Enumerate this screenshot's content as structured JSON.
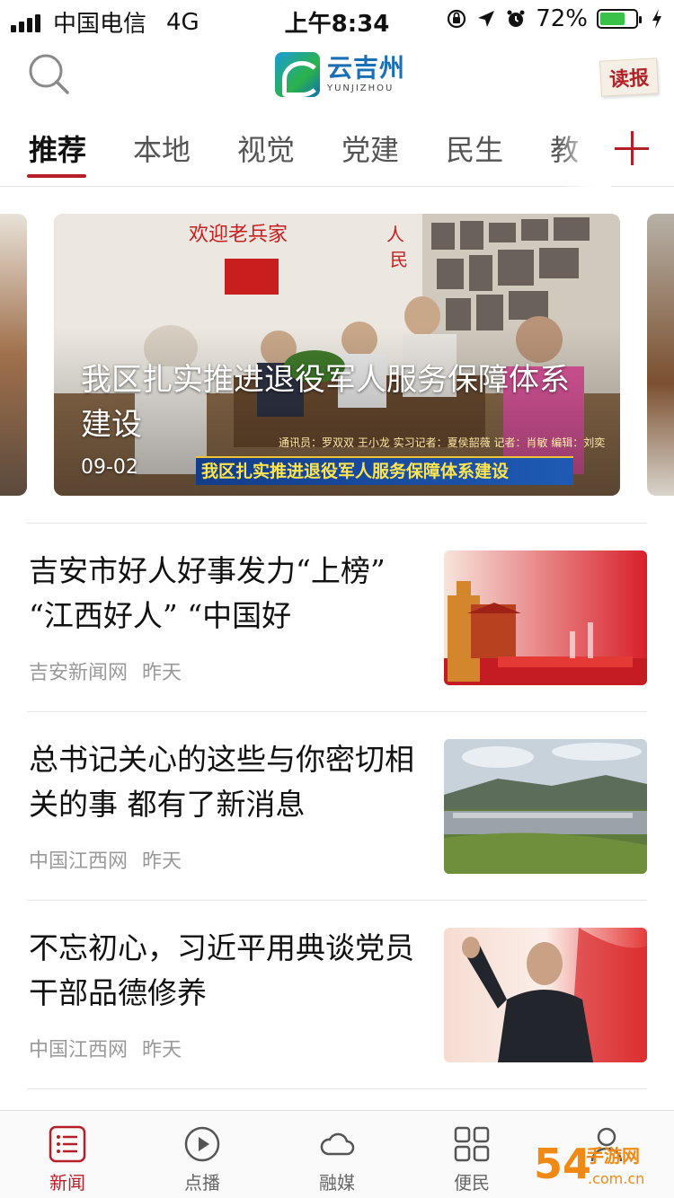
{
  "status_bar": {
    "carrier": "中国电信",
    "network": "4G",
    "time": "上午8:34",
    "battery": "72%",
    "battery_level": 0.72
  },
  "header": {
    "logo_cn": "云吉州",
    "logo_en": "YUNJIZHOU",
    "read_label": "读报"
  },
  "tabs": [
    "推荐",
    "本地",
    "视觉",
    "党建",
    "民生",
    "教"
  ],
  "carousel": {
    "title": "我区扎实推进退役军人服务保障体系建设",
    "date": "09-02",
    "banner_caption": "我区扎实推进退役军人服务保障体系建设",
    "banner_credit": "通讯员：罗双双 王小龙 实习记者：夏侯韶薇 记者：肖敏 编辑：刘奕"
  },
  "news": [
    {
      "title": "吉安市好人好事发力“上榜” “江西好人” “中国好",
      "source": "吉安新闻网",
      "time": "昨天"
    },
    {
      "title": "总书记关心的这些与你密切相关的事 都有了新消息",
      "source": "中国江西网",
      "time": "昨天"
    },
    {
      "title": "不忘初心，习近平用典谈党员干部品德修养",
      "source": "中国江西网",
      "time": "昨天"
    }
  ],
  "tabbar": [
    "新闻",
    "点播",
    "融媒",
    "便民",
    ""
  ],
  "watermark": "54手游网",
  "colors": {
    "accent": "#b81e2a",
    "battery": "#39c24a",
    "logo_blue": "#1a6fb5"
  }
}
